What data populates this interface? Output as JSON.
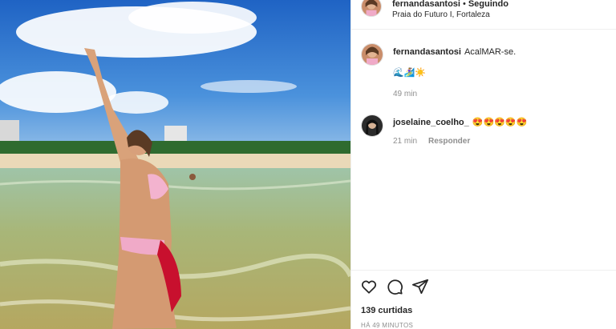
{
  "post": {
    "username": "fernandasantosi",
    "separator": "•",
    "follow_label": "Seguindo",
    "location": "Praia do Futuro I, Fortaleza"
  },
  "caption": {
    "username": "fernandasantosi",
    "text": "AcalMAR-se.",
    "emoji_line": "🌊🏄‍♀️☀️",
    "time": "49 min"
  },
  "comment": {
    "username": "joselaine_coelho_",
    "emojis": "😍😍😍😍😍",
    "time": "21 min",
    "reply_label": "Responder"
  },
  "actions": {
    "icons": [
      "heart-icon",
      "comment-icon",
      "share-icon"
    ],
    "likes_label": "139 curtidas",
    "timestamp": "HÁ 49 MINUTOS"
  },
  "colors": {
    "text": "#262626",
    "secondary": "#8e8e8e",
    "divider": "#efefef",
    "sky": "#3d86d6",
    "sea": "#a9b878"
  }
}
